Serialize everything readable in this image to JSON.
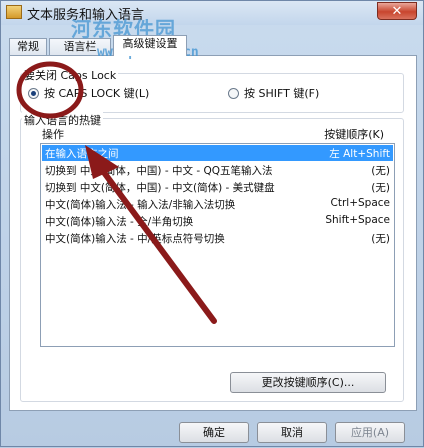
{
  "window": {
    "title": "文本服务和输入语言",
    "close_label": "✕"
  },
  "watermark": {
    "site_name": "河东软件园",
    "url": "www.pc0359.cn"
  },
  "tabs": [
    {
      "label": "常规"
    },
    {
      "label": "语言栏"
    },
    {
      "label": "高级键设置"
    }
  ],
  "capslock_group": {
    "title": "要关闭 Caps Lock",
    "option_capslock": "按 CAPS LOCK 键(L)",
    "option_shift": "按 SHIFT 键(F)",
    "selected": "capslock"
  },
  "hotkeys_group": {
    "title": "输入语言的热键",
    "col_action": "操作",
    "col_key": "按键顺序(K)",
    "rows": [
      {
        "action": "在输入语言之间",
        "key": "左 Alt+Shift",
        "selected": true
      },
      {
        "action": "切换到 中文(简体，中国) - 中文 - QQ五笔输入法",
        "key": "(无)"
      },
      {
        "action": "切换到 中文(简体，中国) - 中文(简体) - 美式键盘",
        "key": "(无)"
      },
      {
        "action": "中文(简体)输入法 - 输入法/非输入法切换",
        "key": "Ctrl+Space"
      },
      {
        "action": "中文(简体)输入法 - 全/半角切换",
        "key": "Shift+Space"
      },
      {
        "action": "中文(简体)输入法 - 中/英标点符号切换",
        "key": "(无)"
      }
    ],
    "change_button": "更改按键顺序(C)..."
  },
  "footer": {
    "ok": "确定",
    "cancel": "取消",
    "apply": "应用(A)"
  },
  "colors": {
    "selection": "#3399ff",
    "annotation": "#8b1a1a"
  }
}
